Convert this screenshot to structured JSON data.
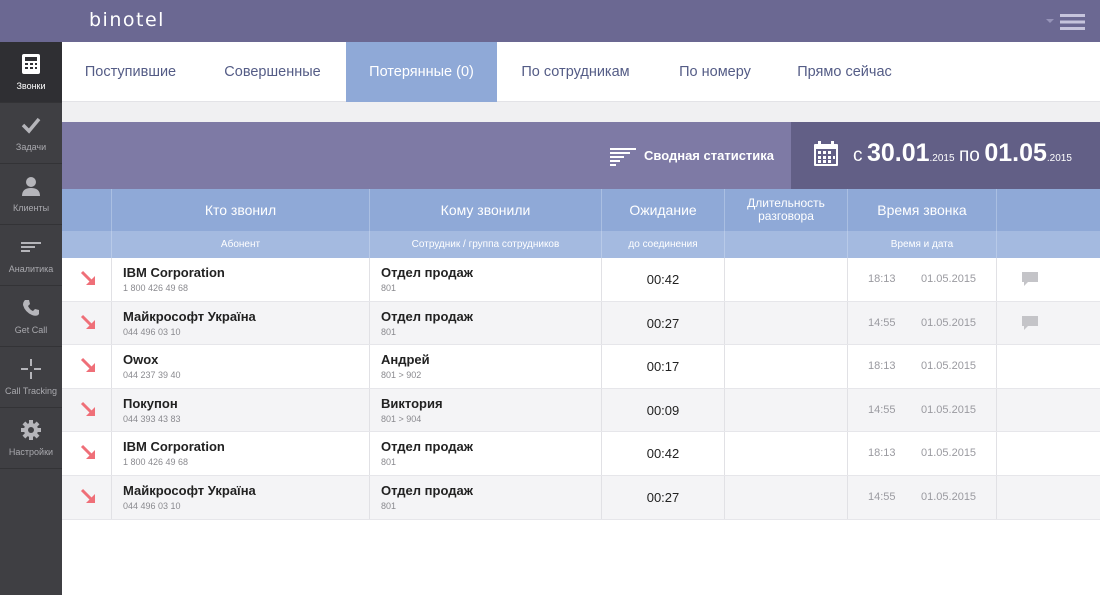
{
  "app": {
    "logo": "binotel"
  },
  "colors": {
    "header": "#6b6892",
    "active_tab": "#8fa9d7",
    "missed_arrow": "#ef6f78"
  },
  "sidebar": {
    "items": [
      {
        "label": "Звонки",
        "icon": "phone-icon",
        "active": true
      },
      {
        "label": "Задачи",
        "icon": "checkmark-icon"
      },
      {
        "label": "Клиенты",
        "icon": "person-icon"
      },
      {
        "label": "Аналитика",
        "icon": "analytics-bars-icon"
      },
      {
        "label": "Get Call",
        "icon": "handset-icon"
      },
      {
        "label": "Call Tracking",
        "icon": "crosshair-icon"
      },
      {
        "label": "Настройки",
        "icon": "gear-icon"
      }
    ]
  },
  "tabs": [
    {
      "label": "Поступившие"
    },
    {
      "label": "Совершенные"
    },
    {
      "label": "Потерянные (0)",
      "active": true
    },
    {
      "label": "По сотрудникам"
    },
    {
      "label": "По номеру"
    },
    {
      "label": "Прямо сейчас"
    }
  ],
  "stats": {
    "summary_label": "Сводная статистика",
    "from_word": "с",
    "from_date": "30.01",
    "from_year": ".2015",
    "to_word": "по",
    "to_date": "01.05",
    "to_year": ".2015"
  },
  "table": {
    "headers": [
      {
        "title": "Кто звонил",
        "sub": "Абонент"
      },
      {
        "title": "Кому звонили",
        "sub": "Сотрудник / группа сотрудников"
      },
      {
        "title": "Ожидание",
        "sub": "до соединения"
      },
      {
        "title": "Длительность разговора",
        "sub": ""
      },
      {
        "title": "Время звонка",
        "sub": "Время и дата"
      }
    ],
    "rows": [
      {
        "caller": "IBM Corporation",
        "caller_phone": "1 800 426 49 68",
        "callee": "Отдел продаж",
        "callee_ext": "801",
        "wait": "00:42",
        "time": "18:13",
        "date": "01.05.2015",
        "comment": true
      },
      {
        "caller": "Майкрософт Україна",
        "caller_phone": "044 496 03 10",
        "callee": "Отдел продаж",
        "callee_ext": "801",
        "wait": "00:27",
        "time": "14:55",
        "date": "01.05.2015",
        "comment": true
      },
      {
        "caller": "Owox",
        "caller_phone": "044 237 39 40",
        "callee": "Андрей",
        "callee_ext": "801 > 902",
        "wait": "00:17",
        "time": "18:13",
        "date": "01.05.2015",
        "comment": false
      },
      {
        "caller": "Покупон",
        "caller_phone": "044 393 43 83",
        "callee": "Виктория",
        "callee_ext": "801 > 904",
        "wait": "00:09",
        "time": "14:55",
        "date": "01.05.2015",
        "comment": false
      },
      {
        "caller": "IBM Corporation",
        "caller_phone": "1 800 426 49 68",
        "callee": "Отдел продаж",
        "callee_ext": "801",
        "wait": "00:42",
        "time": "18:13",
        "date": "01.05.2015",
        "comment": false
      },
      {
        "caller": "Майкрософт Україна",
        "caller_phone": "044 496 03 10",
        "callee": "Отдел продаж",
        "callee_ext": "801",
        "wait": "00:27",
        "time": "14:55",
        "date": "01.05.2015",
        "comment": false
      }
    ]
  }
}
